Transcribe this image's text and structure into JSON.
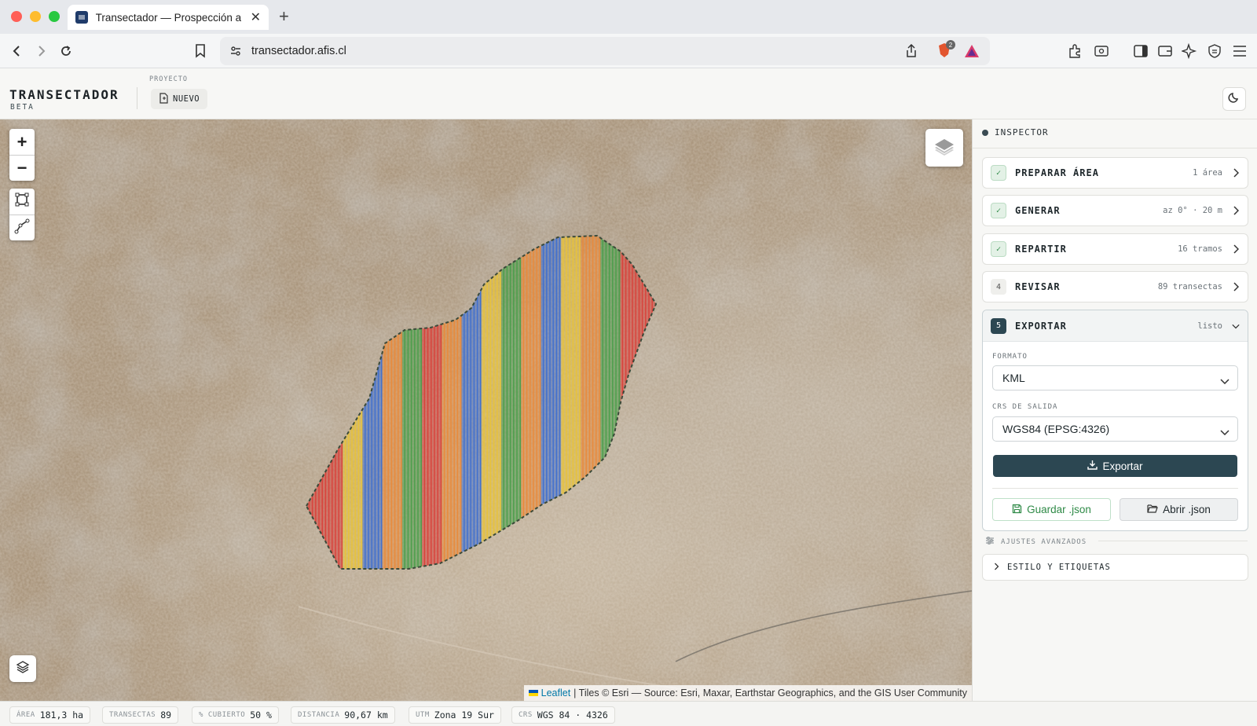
{
  "browser": {
    "tab_title": "Transectador — Prospección a",
    "url": "transectador.afis.cl",
    "shield_badge": "2"
  },
  "header": {
    "brand": "TRANSECTADOR",
    "brand_sub": "BETA",
    "project_label": "PROYECTO",
    "new_button": "NUEVO"
  },
  "map": {
    "zoom_in": "+",
    "zoom_out": "−",
    "attribution_leaflet": "Leaflet",
    "attribution_rest": "| Tiles © Esri — Source: Esri, Maxar, Earthstar Geographics, and the GIS User Community",
    "strip_colors": [
      "#d9413a",
      "#e8c23a",
      "#3f6fcf",
      "#e98a3a",
      "#4a9e4a"
    ]
  },
  "inspector": {
    "title": "INSPECTOR",
    "steps": [
      {
        "badge": "✓",
        "title": "PREPARAR ÁREA",
        "meta": "1 área"
      },
      {
        "badge": "✓",
        "title": "GENERAR",
        "meta": "az 0° · 20 m"
      },
      {
        "badge": "✓",
        "title": "REPARTIR",
        "meta": "16 tramos"
      },
      {
        "badge": "4",
        "title": "REVISAR",
        "meta": "89 transectas"
      }
    ],
    "export": {
      "badge": "5",
      "title": "EXPORTAR",
      "meta": "listo",
      "format_label": "FORMATO",
      "format_value": "KML",
      "crs_label": "CRS DE SALIDA",
      "crs_value": "WGS84 (EPSG:4326)",
      "export_button": "Exportar",
      "save_json": "Guardar .json",
      "open_json": "Abrir .json"
    },
    "advanced_label": "AJUSTES AVANZADOS",
    "style_labels": "ESTILO Y ETIQUETAS"
  },
  "status": [
    {
      "k": "ÁREA",
      "v": "181,3 ha"
    },
    {
      "k": "TRANSECTAS",
      "v": "89"
    },
    {
      "k": "% CUBIERTO",
      "v": "50 %"
    },
    {
      "k": "DISTANCIA",
      "v": "90,67 km"
    },
    {
      "k": "UTM",
      "v": "Zona 19 Sur"
    },
    {
      "k": "CRS",
      "v": "WGS 84 · 4326"
    }
  ]
}
